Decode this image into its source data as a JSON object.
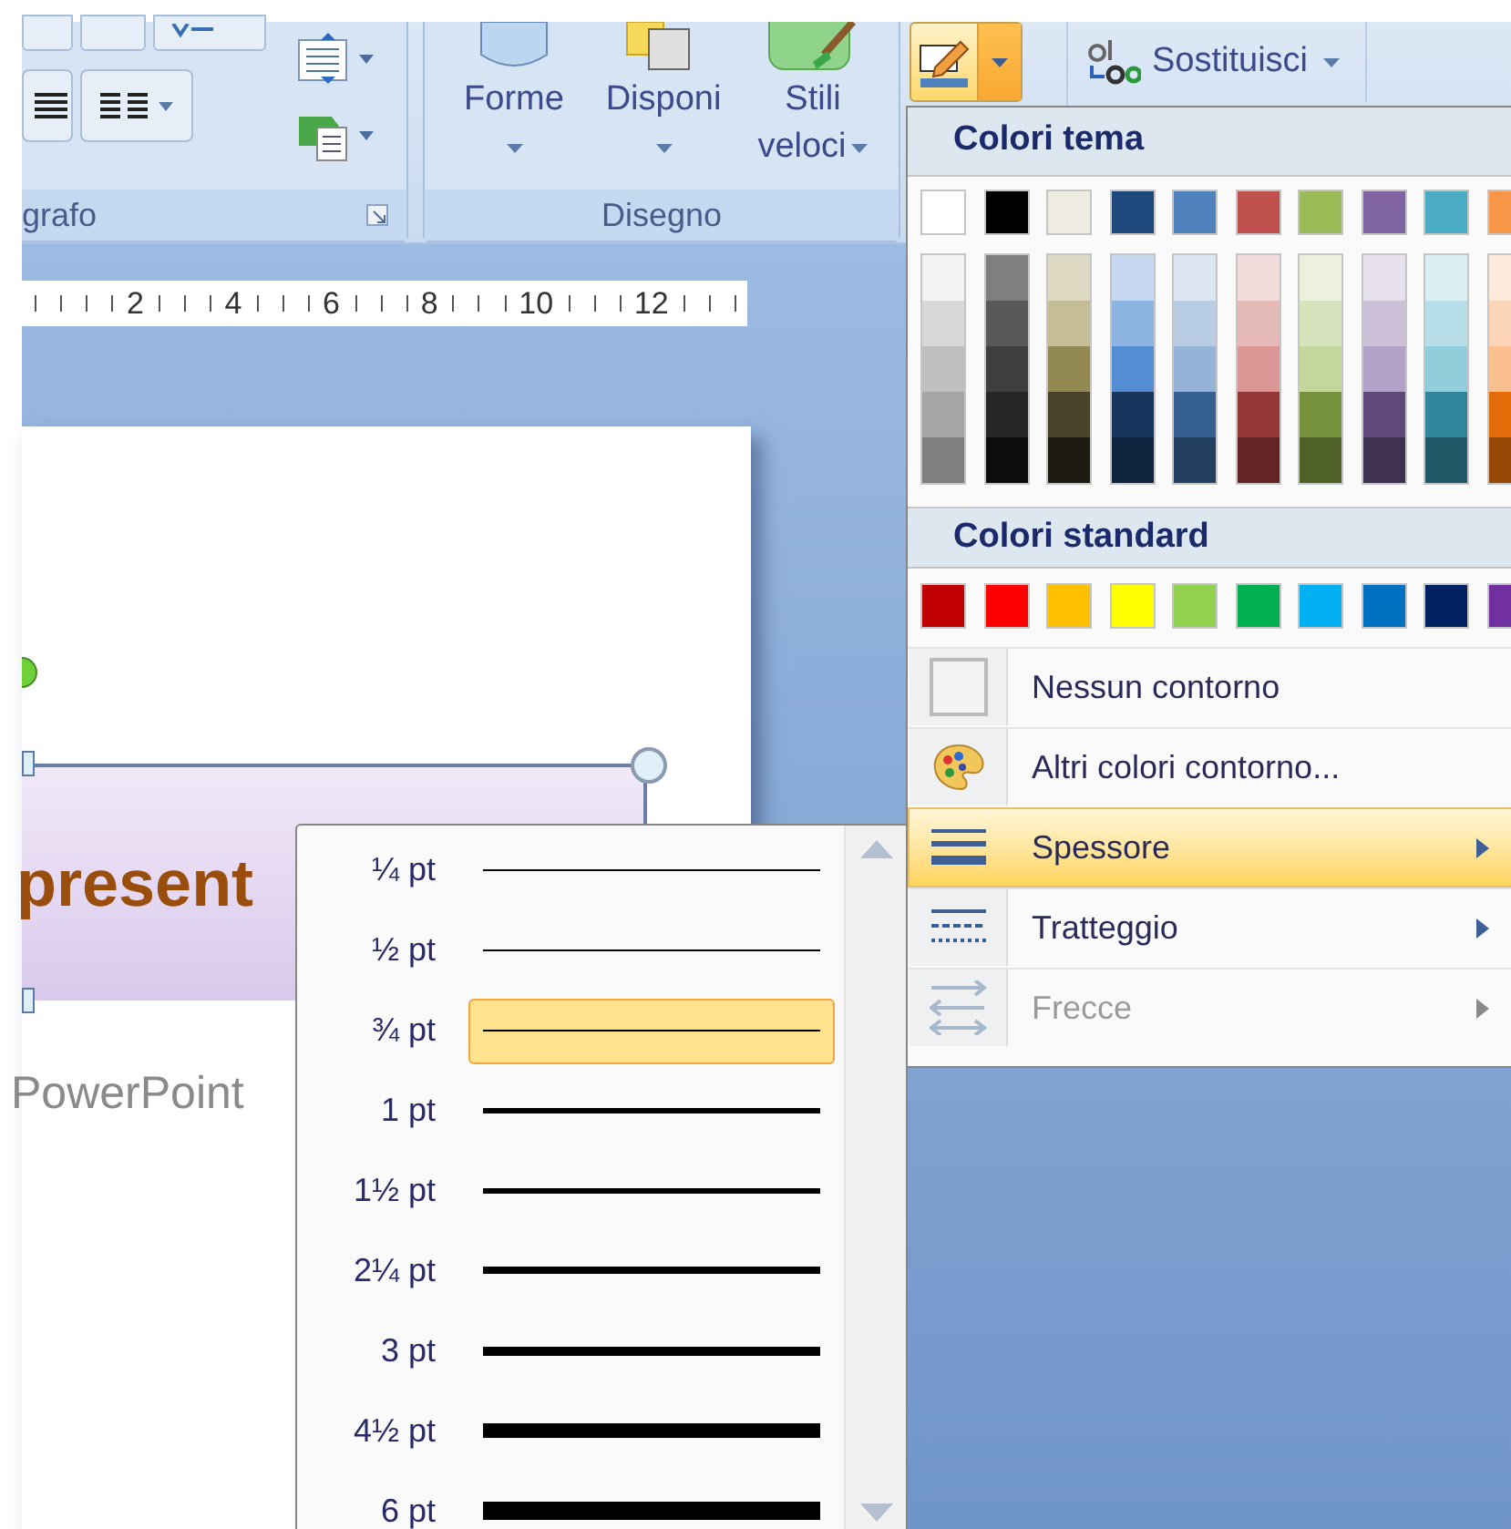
{
  "ribbon": {
    "paragraph_group": {
      "label": "grafo"
    },
    "drawing_group": {
      "label": "Disegno",
      "buttons": [
        {
          "label": "Forme",
          "kind": "shapes"
        },
        {
          "label": "Disponi",
          "kind": "arrange"
        },
        {
          "label": "Stili veloci",
          "kind": "styles"
        }
      ]
    },
    "outline_button": {
      "expanded": true
    },
    "replace_button": {
      "label": "Sostituisci"
    }
  },
  "ruler": {
    "numbers": [
      "2",
      "4",
      "6",
      "8",
      "10",
      "12"
    ]
  },
  "slide": {
    "title": "present",
    "subtitle": "PowerPoint"
  },
  "outline_menu": {
    "theme_header": "Colori tema",
    "theme_colors": [
      {
        "color": "#ffffff",
        "shades": [
          {
            "color": "#f2f2f2"
          },
          {
            "color": "#d8d8d8"
          },
          {
            "color": "#bfbfbf"
          },
          {
            "color": "#a5a5a5"
          },
          {
            "color": "#7f7f7f"
          }
        ]
      },
      {
        "color": "#000000",
        "shades": [
          {
            "color": "#7f7f7f"
          },
          {
            "color": "#595959"
          },
          {
            "color": "#3f3f3f"
          },
          {
            "color": "#262626"
          },
          {
            "color": "#0c0c0c"
          }
        ]
      },
      {
        "color": "#eeece1",
        "shades": [
          {
            "color": "#ddd9c3"
          },
          {
            "color": "#c4bd97"
          },
          {
            "color": "#938953"
          },
          {
            "color": "#494429"
          },
          {
            "color": "#1d1b10"
          }
        ]
      },
      {
        "color": "#1f497d",
        "shades": [
          {
            "color": "#c6d9f0"
          },
          {
            "color": "#8db3e2"
          },
          {
            "color": "#548dd4"
          },
          {
            "color": "#17365d"
          },
          {
            "color": "#0f243e"
          }
        ]
      },
      {
        "color": "#4f81bd",
        "shades": [
          {
            "color": "#dbe5f1"
          },
          {
            "color": "#b8cce4"
          },
          {
            "color": "#95b3d7"
          },
          {
            "color": "#366092"
          },
          {
            "color": "#244061"
          }
        ]
      },
      {
        "color": "#c0504d",
        "shades": [
          {
            "color": "#f2dcdb"
          },
          {
            "color": "#e5b9b7"
          },
          {
            "color": "#d99694"
          },
          {
            "color": "#953734"
          },
          {
            "color": "#632423"
          }
        ]
      },
      {
        "color": "#9bbb59",
        "shades": [
          {
            "color": "#ebf1dd"
          },
          {
            "color": "#d7e3bc"
          },
          {
            "color": "#c3d69b"
          },
          {
            "color": "#76923c"
          },
          {
            "color": "#4f6128"
          }
        ]
      },
      {
        "color": "#8064a2",
        "shades": [
          {
            "color": "#e5e0ec"
          },
          {
            "color": "#ccc1d9"
          },
          {
            "color": "#b2a2c7"
          },
          {
            "color": "#5f497a"
          },
          {
            "color": "#3f3151"
          }
        ]
      },
      {
        "color": "#4bacc6",
        "shades": [
          {
            "color": "#dbeef3"
          },
          {
            "color": "#b7dde8"
          },
          {
            "color": "#92cddc"
          },
          {
            "color": "#31859b"
          },
          {
            "color": "#205867"
          }
        ]
      },
      {
        "color": "#f79646",
        "shades": [
          {
            "color": "#fdeada"
          },
          {
            "color": "#fbd5b5"
          },
          {
            "color": "#fac08f"
          },
          {
            "color": "#e36c09"
          },
          {
            "color": "#974806"
          }
        ]
      }
    ],
    "standard_header": "Colori standard",
    "standard_colors": [
      {
        "color": "#c00000"
      },
      {
        "color": "#ff0000"
      },
      {
        "color": "#ffc000"
      },
      {
        "color": "#ffff00"
      },
      {
        "color": "#92d050"
      },
      {
        "color": "#00b050"
      },
      {
        "color": "#00b0f0"
      },
      {
        "color": "#0070c0"
      },
      {
        "color": "#002060"
      },
      {
        "color": "#7030a0"
      }
    ],
    "items": [
      {
        "label": "Nessun contorno",
        "kind": "no-outline",
        "selected": false,
        "disabled": false,
        "submenu": false
      },
      {
        "label": "Altri colori contorno...",
        "kind": "more-colors",
        "selected": false,
        "disabled": false,
        "submenu": false
      },
      {
        "label": "Spessore",
        "kind": "weight",
        "selected": true,
        "disabled": false,
        "submenu": true
      },
      {
        "label": "Tratteggio",
        "kind": "dashes",
        "selected": false,
        "disabled": false,
        "submenu": true
      },
      {
        "label": "Frecce",
        "kind": "arrows",
        "selected": false,
        "disabled": true,
        "submenu": true
      }
    ]
  },
  "weight_menu": {
    "items": [
      {
        "label": "¼ pt",
        "selected": false
      },
      {
        "label": "½ pt",
        "selected": false
      },
      {
        "label": "¾ pt",
        "selected": true
      },
      {
        "label": "1 pt",
        "selected": false
      },
      {
        "label": "1½ pt",
        "selected": false
      },
      {
        "label": "2¼ pt",
        "selected": false
      },
      {
        "label": "3 pt",
        "selected": false
      },
      {
        "label": "4½ pt",
        "selected": false
      },
      {
        "label": "6 pt",
        "selected": false
      }
    ]
  }
}
